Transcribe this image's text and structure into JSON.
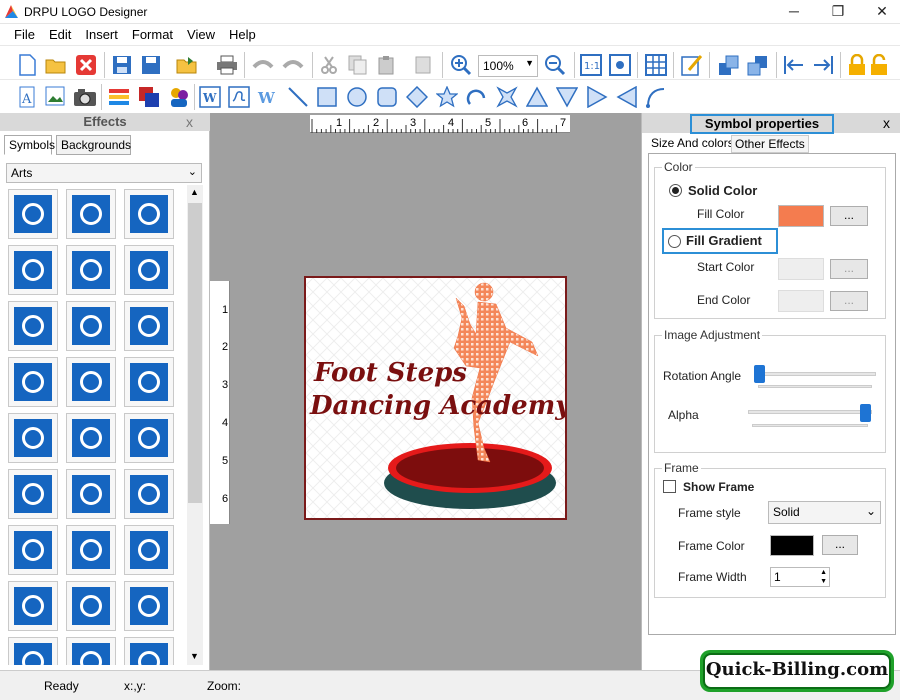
{
  "app": {
    "title": "DRPU LOGO Designer"
  },
  "window_controls": {
    "minimize": "─",
    "maximize": "❐",
    "close": "✕"
  },
  "menu": [
    "File",
    "Edit",
    "Insert",
    "Format",
    "View",
    "Help"
  ],
  "toolbar": {
    "zoom_value": "100%"
  },
  "effects": {
    "title": "Effects",
    "close": "x",
    "tabs": [
      "Symbols",
      "Backgrounds"
    ],
    "category": "Arts"
  },
  "canvas": {
    "ruler_h_labels": [
      "1",
      "2",
      "3",
      "4",
      "5",
      "6",
      "7"
    ],
    "ruler_v_labels": [
      "1",
      "2",
      "3",
      "4",
      "5",
      "6"
    ],
    "logo_line1": "Foot Steps",
    "logo_line2": "Dancing Academy"
  },
  "props": {
    "title": "Symbol properties",
    "close": "x",
    "tabs": [
      "Size And colors",
      "Other Effects"
    ],
    "color_group": "Color",
    "solid_color": "Solid Color",
    "fill_color_label": "Fill Color",
    "fill_color": "#f47c4f",
    "fill_gradient": "Fill Gradient",
    "start_color_label": "Start Color",
    "end_color_label": "End Color",
    "dots": "...",
    "image_adjustment": "Image Adjustment",
    "rotation_label": "Rotation Angle",
    "alpha_label": "Alpha",
    "rotation_value": 0,
    "alpha_value": 1,
    "frame_group": "Frame",
    "show_frame": "Show Frame",
    "frame_style_label": "Frame style",
    "frame_style": "Solid",
    "frame_color_label": "Frame Color",
    "frame_color": "#000000",
    "frame_width_label": "Frame Width",
    "frame_width": "1"
  },
  "status": {
    "ready": "Ready",
    "coords": "x:,y:",
    "zoom": "Zoom:"
  },
  "watermark": "Quick-Billing.com"
}
